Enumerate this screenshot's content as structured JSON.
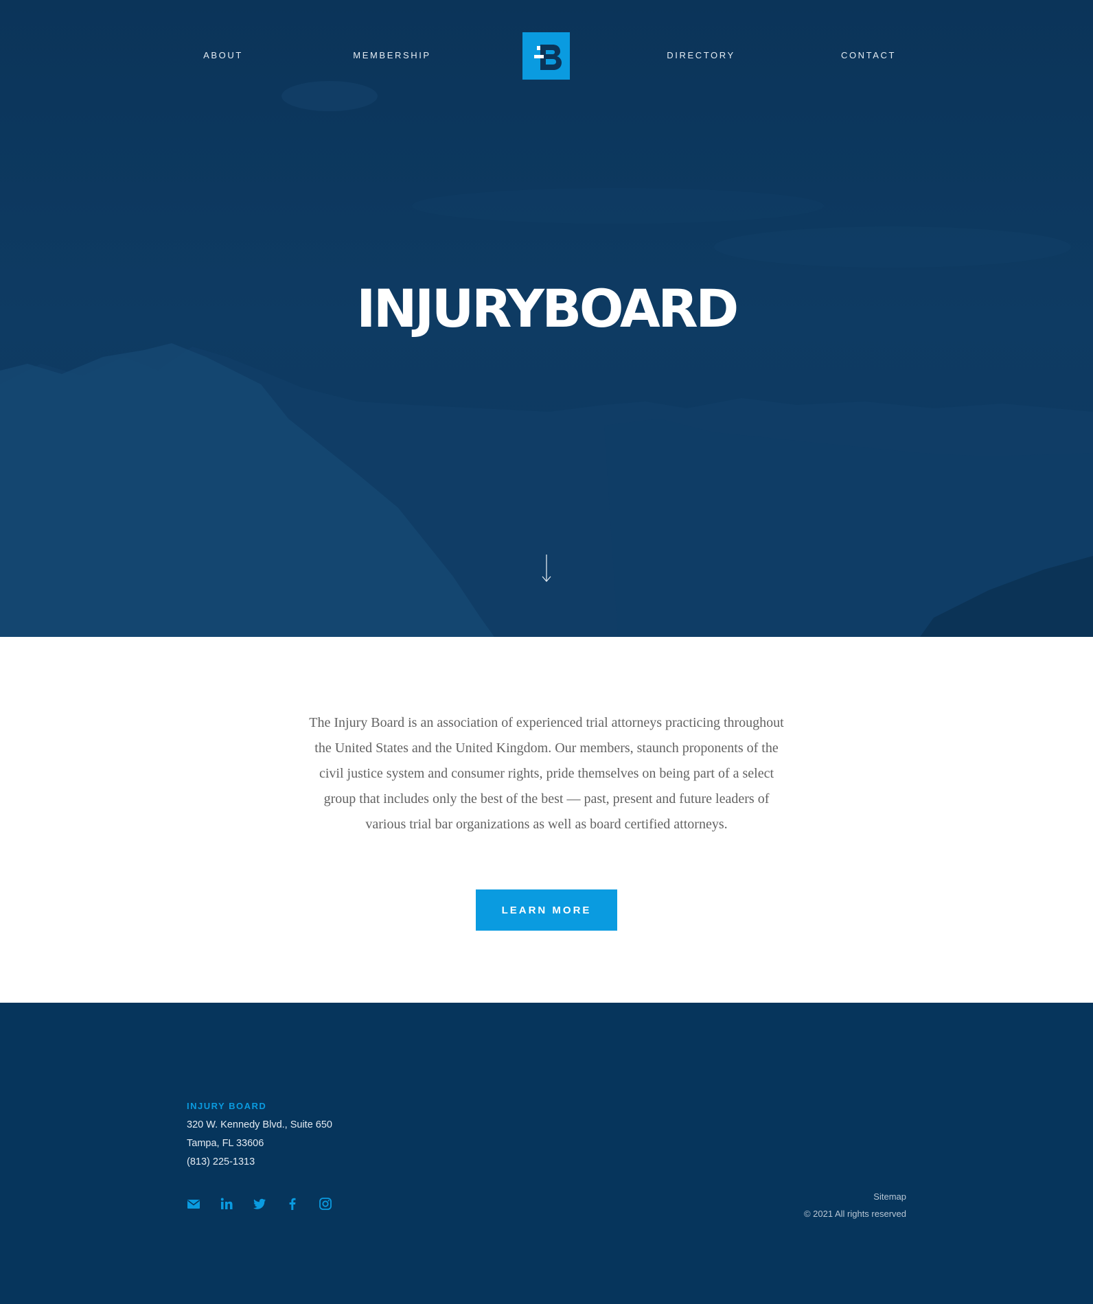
{
  "nav": {
    "about": "About",
    "membership": "Membership",
    "directory": "Directory",
    "contact": "Contact"
  },
  "hero": {
    "title": "INJURYBOARD"
  },
  "about": {
    "body": "The Injury Board is an association of experienced trial attorneys practicing throughout the United States and the United Kingdom. Our members, staunch proponents of the civil justice system and consumer rights, pride themselves on being part of a select group that includes only the best of the best — past, present and future leaders of various trial bar organizations as well as board certified attorneys.",
    "button_label": "Learn More"
  },
  "footer": {
    "brand": "INJURY BOARD",
    "address_line1": "320 W. Kennedy Blvd., Suite 650",
    "address_line2": "Tampa, FL 33606",
    "phone": "(813) 225-1313",
    "social_icons": [
      "email-icon",
      "linkedin-icon",
      "twitter-icon",
      "facebook-icon",
      "instagram-icon"
    ],
    "sitemap_label": "Sitemap",
    "copyright": "© 2021 All rights reserved"
  },
  "colors": {
    "hero_bg": "#0d3960",
    "accent": "#0a9be0",
    "footer_bg": "#06355c",
    "body_text": "#626262"
  }
}
